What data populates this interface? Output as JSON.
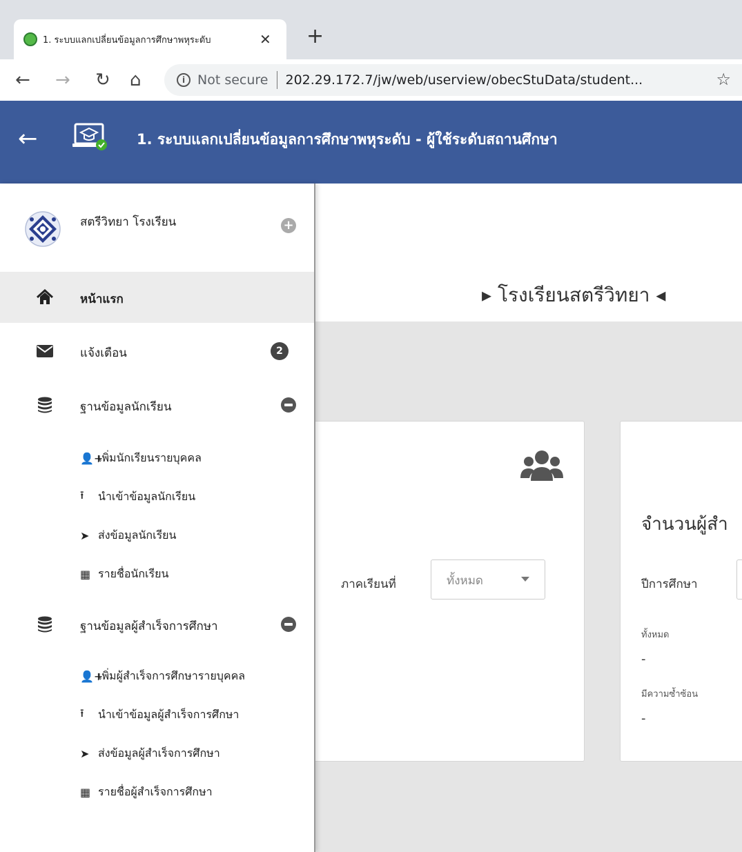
{
  "browser": {
    "tab_title": "1. ระบบแลกเปลี่ยนข้อมูลการศึกษาพหุระดับ",
    "tab_close": "✕",
    "new_tab": "+",
    "security_label": "Not secure",
    "url": "202.29.172.7/jw/web/userview/obecStuData/student..."
  },
  "header": {
    "title": "1. ระบบแลกเปลี่ยนข้อมูลการศึกษาพหุระดับ - ผู้ใช้ระดับสถานศึกษา",
    "color": "#3c5b9a"
  },
  "sidebar": {
    "profile_name": "สตรีวิทยา โรงเรียน",
    "items": {
      "home": {
        "label": "หน้าแรก"
      },
      "notify": {
        "label": "แจ้งเตือน",
        "badge": "2"
      },
      "student_db": {
        "label": "ฐานข้อมูลนักเรียน"
      },
      "graduate_db": {
        "label": "ฐานข้อมูลผู้สำเร็จการศึกษา"
      }
    },
    "student_sub": [
      {
        "icon": "user-plus-icon",
        "label": "เพิ่มนักเรียนรายบุคคล"
      },
      {
        "icon": "upload-icon",
        "label": "นำเข้าข้อมูลนักเรียน"
      },
      {
        "icon": "send-icon",
        "label": "ส่งข้อมูลนักเรียน"
      },
      {
        "icon": "table-icon",
        "label": "รายชื่อนักเรียน"
      }
    ],
    "graduate_sub": [
      {
        "icon": "user-plus-icon",
        "label": "เพิ่มผู้สำเร็จการศึกษารายบุคคล"
      },
      {
        "icon": "upload-icon",
        "label": "นำเข้าข้อมูลผู้สำเร็จการศึกษา"
      },
      {
        "icon": "send-icon",
        "label": "ส่งข้อมูลผู้สำเร็จการศึกษา"
      },
      {
        "icon": "table-icon",
        "label": "รายชื่อผู้สำเร็จการศึกษา"
      }
    ]
  },
  "main": {
    "school_title": "▸ โรงเรียนสตรีวิทยา ◂",
    "card_a": {
      "semester_label": "ภาคเรียนที่",
      "semester_value": "ทั้งหมด"
    },
    "card_b": {
      "title": "จำนวนผู้สำ",
      "year_label": "ปีการศึกษา",
      "stat_total_label": "ทั้งหมด",
      "stat_total_value": "-",
      "stat_dup_label": "มีความซ้ำซ้อน",
      "stat_dup_value": "-"
    }
  }
}
